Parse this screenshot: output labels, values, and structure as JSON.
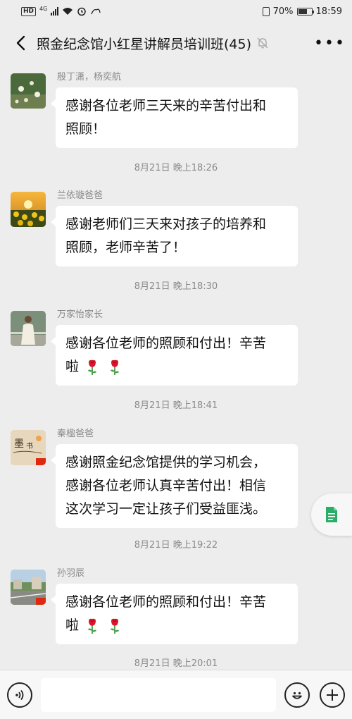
{
  "status_bar": {
    "hd": "HD",
    "net": "4G",
    "battery": "70%",
    "battery_level": 0.7,
    "time": "18:59"
  },
  "nav": {
    "title": "照金纪念馆小红星讲解员培训班(45)",
    "icons": [
      "back-icon",
      "mute-icon",
      "more-icon"
    ]
  },
  "messages": [
    {
      "sender": "殷丁潇，杨奕航",
      "lines": [
        "感谢各位老师三天来的辛苦付出和",
        "照顾！"
      ],
      "avatar": "flower-photo"
    },
    {
      "sender": "兰依璇爸爸",
      "lines": [
        "感谢老师们三天来对孩子的培养和",
        "照顾，老师辛苦了！"
      ],
      "avatar": "sunflower-photo"
    },
    {
      "sender": "万家怡家长",
      "lines": [
        "感谢各位老师的照顾和付出！辛苦",
        "啦"
      ],
      "avatar": "girl-photo",
      "roses": 2
    },
    {
      "sender": "秦楹爸爸",
      "lines": [
        "感谢照金纪念馆提供的学习机会，",
        "感谢各位老师认真辛苦付出！相信",
        "这次学习一定让孩子们受益匪浅。"
      ],
      "avatar": "calligraphy-photo"
    },
    {
      "sender": "孙羽辰",
      "lines": [
        "感谢各位老师的照顾和付出！辛苦",
        "啦"
      ],
      "avatar": "street-photo",
      "roses": 2
    }
  ],
  "timestamps": [
    "8月21日 晚上18:26",
    "8月21日 晚上18:30",
    "8月21日 晚上18:41",
    "8月21日 晚上19:22",
    "8月21日 晚上20:01"
  ],
  "input_bar": {
    "text": "",
    "icons": [
      "voice-icon",
      "emoji-icon",
      "add-icon"
    ]
  },
  "colors": {
    "background": "#ededed",
    "bubble": "#ffffff",
    "timestamp": "#8a8a8a",
    "doc_icon": "#2aae67"
  }
}
